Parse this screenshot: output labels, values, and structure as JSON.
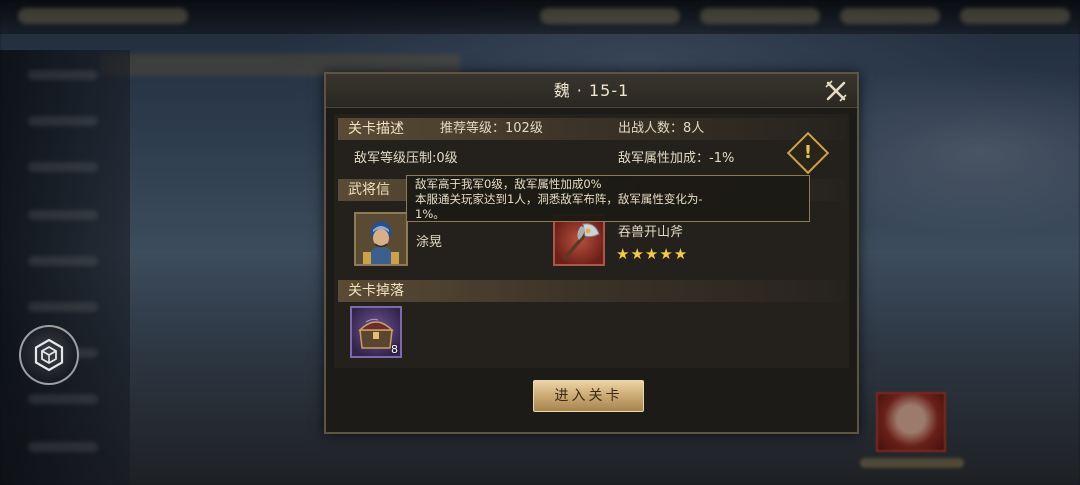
{
  "dialog": {
    "title": "魏 · 15-1",
    "close_icon": "close-x-icon"
  },
  "stage_info": {
    "section_label": "关卡描述",
    "recommended_level": "推荐等级：102级",
    "troop_count": "出战人数：8人",
    "level_suppression": "敌军等级压制:0级",
    "attribute_bonus": "敌军属性加成：-1%",
    "warning_icon": "exclamation-diamond-icon"
  },
  "general_info": {
    "section_label": "武将信",
    "general_name": "涂晃",
    "equipment_name": "吞兽开山斧",
    "equipment_stars": "★★★★★",
    "star_count": 5
  },
  "tooltip": {
    "line1": "敌军高于我军0级，敌军属性加成0%",
    "line2": "本服通关玩家达到1人，洞悉敌军布阵，敌军属性变化为-",
    "line3": "1%。"
  },
  "drops": {
    "section_label": "关卡掉落",
    "items": [
      {
        "icon": "treasure-chest-icon",
        "count": "8"
      }
    ]
  },
  "actions": {
    "enter_label": "进入关卡"
  },
  "side": {
    "menu_icon": "hexagon-cube-icon"
  },
  "colors": {
    "gold_accent": "#c9a24a",
    "button_gold": "#c7a56e",
    "star_yellow": "#f3c94a",
    "panel_dark": "#1d1b18"
  }
}
